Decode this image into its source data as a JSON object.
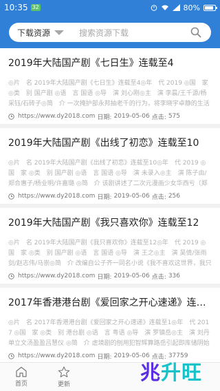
{
  "status": {
    "time": "10:35",
    "badge": "32",
    "battery": "80%"
  },
  "search": {
    "category": "下载资源",
    "placeholder": "搜索资源下载"
  },
  "items": [
    {
      "title": "2019年大陆国产剧《七日生》连载至4",
      "desc": "◎片　名 2019年大陆国产剧《七日生》连载至4◎年　代 2019 ◎国　家 ◎类　别 国产剧 ◎语　言 国语 ◎导　演 刘心刚◎主　演 李晨/王千源/杨采钰/石砖子◎简　介 一次掩护部永邦抽老千的行为，将李晓宇卓静的生活打破。陆扬老…",
      "url": "https://www.dy2018.com",
      "date_label": "日期:",
      "date": "2019-05-06",
      "clicks_label": "点击:",
      "clicks": "575"
    },
    {
      "title": "2019年大陆国产剧《出线了初恋》连载至10",
      "desc": "◎片　名 2019年大陆国产剧《出线了初恋》连载至10◎年　代 2019 ◎国　家 ◎类　别 国产剧 ◎语　言 国语 ◎导　演 未录入◎主　演 陈子由/郑合惠子/杨业明/许嘉璐 ◎简　介 该剧讲述了二次元漫画少女华西亏（郑合惠子 饰）在寻…",
      "url": "https://www.dy2018.com",
      "date_label": "日期:",
      "date": "2019-05-06",
      "clicks_label": "点击:",
      "clicks": "256"
    },
    {
      "title": "2019年大陆国产剧《我只喜欢你》连载至12",
      "desc": "◎片　名 2019年大陆国产剧《我只喜欢你》连载至12◎年　代 2019 ◎国　家 ◎类　别 国产剧 ◎语　言 国语 ◎导　演 王之◎主　演 吴倩/张雨剑/赵志伟/马崇◎简　介 改编自公子齐一同名小说《我不喜欢这世界，我只喜欢你》，源自…",
      "url": "https://www.dy2018.com",
      "date_label": "日期:",
      "date": "2019-05-06",
      "clicks_label": "点击:",
      "clicks": "336"
    },
    {
      "title": "2017年香港港台剧《爱回家之开心速递》连载至5…",
      "desc": "◎片　名 2017年香港港台剧《爱回家之开心速递》连载至1◎年　代 2017 ◎国　家 ◎类　别 港台剧 ◎语　言 粤语 ◎导　演 罗镇岳◎主　演 刘丹单立文汤盈盈吕慧仪 ◎简　介 虐境剧的刨用犯智辉算路岳引起即库储阴始前一套成功剧，曾…",
      "url": "https://www.dy2018.com",
      "date_label": "日期:",
      "date": "2019-05-06",
      "clicks_label": "点击:",
      "clicks": "37759"
    }
  ],
  "tabs": [
    {
      "label": "首页",
      "icon": "home-icon"
    },
    {
      "label": "更新",
      "icon": "star-icon"
    }
  ],
  "watermark": {
    "part1": "兆",
    "part2": "升旺"
  },
  "colors": {
    "header": "#2f80d6",
    "watermark_purple": "#5a2ee3",
    "watermark_cyan": "#14c3c9"
  }
}
